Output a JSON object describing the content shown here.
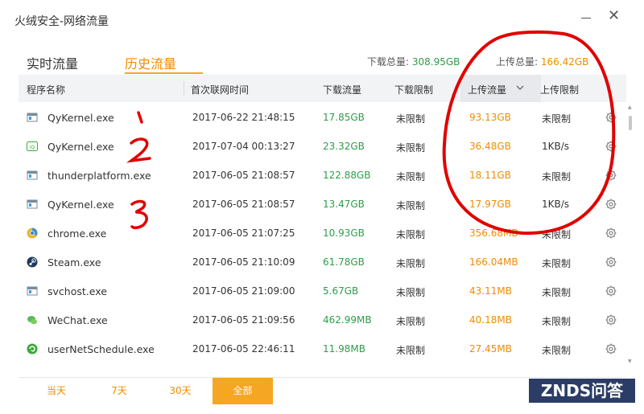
{
  "window": {
    "title": "火绒安全-网络流量",
    "close_glyph": "✕"
  },
  "tabs": [
    {
      "label": "实时流量"
    },
    {
      "label": "历史流量"
    }
  ],
  "totals": {
    "download_label": "下载总量:",
    "download_value": "308.95GB",
    "upload_label": "上传总量:",
    "upload_value": "166.42GB"
  },
  "columns": {
    "name": "程序名称",
    "first_time": "首次联网时间",
    "download": "下载流量",
    "download_limit": "下载限制",
    "upload": "上传流量",
    "upload_limit": "上传限制"
  },
  "rows": [
    {
      "icon": "app-window-icon",
      "name": "QyKernel.exe",
      "time": "2017-06-22 21:48:15",
      "download": "17.85GB",
      "download_limit": "未限制",
      "upload": "93.13GB",
      "upload_limit": "未限制"
    },
    {
      "icon": "iqiyi-icon",
      "name": "QyKernel.exe",
      "time": "2017-07-04 00:13:27",
      "download": "23.32GB",
      "download_limit": "未限制",
      "upload": "36.48GB",
      "upload_limit": "1KB/s"
    },
    {
      "icon": "app-window-icon",
      "name": "thunderplatform.exe",
      "time": "2017-06-05 21:08:57",
      "download": "122.88GB",
      "download_limit": "未限制",
      "upload": "18.11GB",
      "upload_limit": "未限制"
    },
    {
      "icon": "app-window-icon",
      "name": "QyKernel.exe",
      "time": "2017-06-05 21:08:57",
      "download": "13.47GB",
      "download_limit": "未限制",
      "upload": "17.97GB",
      "upload_limit": "1KB/s"
    },
    {
      "icon": "chrome-icon",
      "name": "chrome.exe",
      "time": "2017-06-05 21:07:25",
      "download": "10.93GB",
      "download_limit": "未限制",
      "upload": "356.68MB",
      "upload_limit": "未限制"
    },
    {
      "icon": "steam-icon",
      "name": "Steam.exe",
      "time": "2017-06-05 21:10:09",
      "download": "61.78GB",
      "download_limit": "未限制",
      "upload": "166.04MB",
      "upload_limit": "未限制"
    },
    {
      "icon": "app-window-icon",
      "name": "svchost.exe",
      "time": "2017-06-05 21:09:00",
      "download": "5.67GB",
      "download_limit": "未限制",
      "upload": "43.11MB",
      "upload_limit": "未限制"
    },
    {
      "icon": "wechat-icon",
      "name": "WeChat.exe",
      "time": "2017-06-05 21:09:56",
      "download": "462.99MB",
      "download_limit": "未限制",
      "upload": "40.18MB",
      "upload_limit": "未限制"
    },
    {
      "icon": "refresh-app-icon",
      "name": "userNetSchedule.exe",
      "time": "2017-06-05 22:46:11",
      "download": "11.98MB",
      "download_limit": "未限制",
      "upload": "27.45MB",
      "upload_limit": "未限制"
    }
  ],
  "footer": {
    "buttons": [
      {
        "label": "当天"
      },
      {
        "label": "7天"
      },
      {
        "label": "30天"
      },
      {
        "label": "全部"
      }
    ],
    "active_index": 3
  },
  "watermark": "ZNDS问答",
  "colors": {
    "accent": "#f5a623",
    "download": "#2e9d4a",
    "upload": "#f08c00",
    "annotation": "#e00000"
  }
}
